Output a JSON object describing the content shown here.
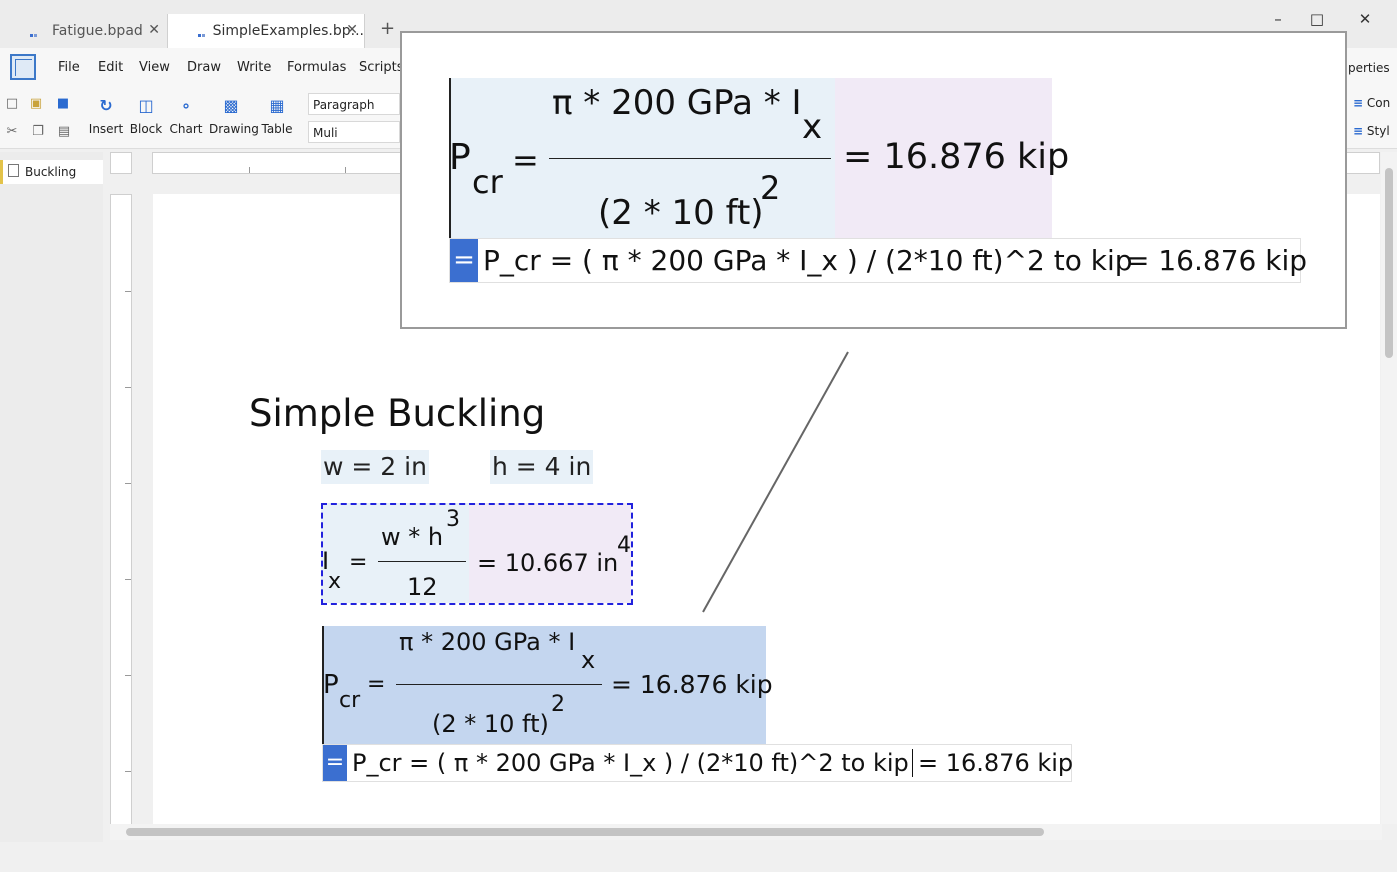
{
  "tabs": [
    {
      "label": "Fatigue.bpad"
    },
    {
      "label": "SimpleExamples.bp..."
    }
  ],
  "window_controls": {
    "minimize": "–",
    "maximize": "□",
    "close": "✕",
    "new_tab": "+"
  },
  "menu": [
    "File",
    "Edit",
    "View",
    "Draw",
    "Write",
    "Formulas",
    "Scripts"
  ],
  "toolbar": {
    "buttons": [
      "Insert",
      "Block",
      "Chart",
      "Drawing",
      "Table"
    ],
    "paragraph_style": "Paragraph",
    "font": "Muli",
    "right_panel_1": "Con",
    "right_panel_2": "Styl",
    "properties_label": "perties"
  },
  "sidebar": {
    "items": [
      {
        "label": "Buckling"
      }
    ]
  },
  "document": {
    "heading": "Simple Buckling",
    "w_def": "w = 2 in",
    "h_def": "h = 4 in",
    "ix": {
      "lhs": "I",
      "lhs_sub": "x",
      "eq": "=",
      "numerator": "w * h",
      "num_exp": "3",
      "denominator": "12",
      "result": "= 10.667 in",
      "result_exp": "4"
    },
    "pcr": {
      "lhs": "P",
      "lhs_sub": "cr",
      "eq": "=",
      "numerator": "π * 200 GPa * I",
      "num_sub": "x",
      "denominator": "(2 * 10 ft)",
      "den_exp": "2",
      "result": "= 16.876 kip",
      "source": "P_cr = ( π * 200 GPa * I_x ) / (2*10 ft)^2 to kip",
      "source_result": "= 16.876 kip",
      "badge": "="
    }
  },
  "colors": {
    "accent": "#3b6fd0",
    "equation_bg": "#e8f1f8",
    "result_bg": "#f1eaf6",
    "selected_bg": "#c4d6ef",
    "dashed_border": "#2222dd"
  }
}
